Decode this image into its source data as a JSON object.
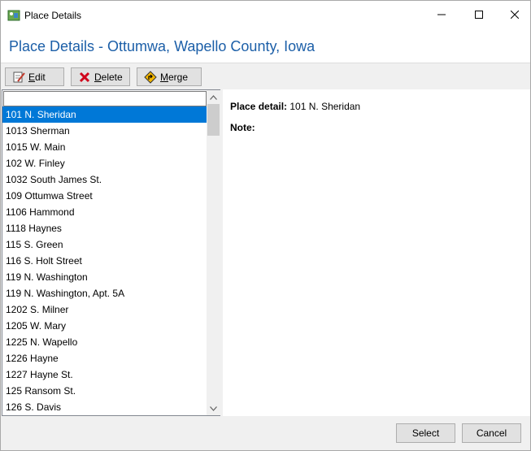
{
  "window": {
    "title": "Place Details",
    "icon": "app-icon"
  },
  "header": {
    "title": "Place Details - Ottumwa, Wapello County, Iowa",
    "color": "#1c5fa8"
  },
  "toolbar": {
    "edit_label": "Edit",
    "delete_label": "Delete",
    "merge_label": "Merge"
  },
  "list": {
    "search_value": "",
    "selected_index": 0,
    "items": [
      "101 N. Sheridan",
      "1013 Sherman",
      "1015 W. Main",
      "102 W. Finley",
      "1032 South James St.",
      "109 Ottumwa Street",
      "1106 Hammond",
      "1118 Haynes",
      "115 S. Green",
      "116 S. Holt Street",
      "119 N. Washington",
      "119 N. Washington, Apt. 5A",
      "1202 S. Milner",
      "1205 W. Mary",
      "1225 N. Wapello",
      "1226 Hayne",
      "1227 Hayne St.",
      "125 Ransom St.",
      "126 S. Davis"
    ]
  },
  "detail": {
    "place_label": "Place detail:",
    "place_value": "101 N. Sheridan",
    "note_label": "Note:",
    "note_value": ""
  },
  "footer": {
    "select_label": "Select",
    "cancel_label": "Cancel"
  },
  "colors": {
    "selection": "#0078d7",
    "accent": "#1c5fa8"
  }
}
